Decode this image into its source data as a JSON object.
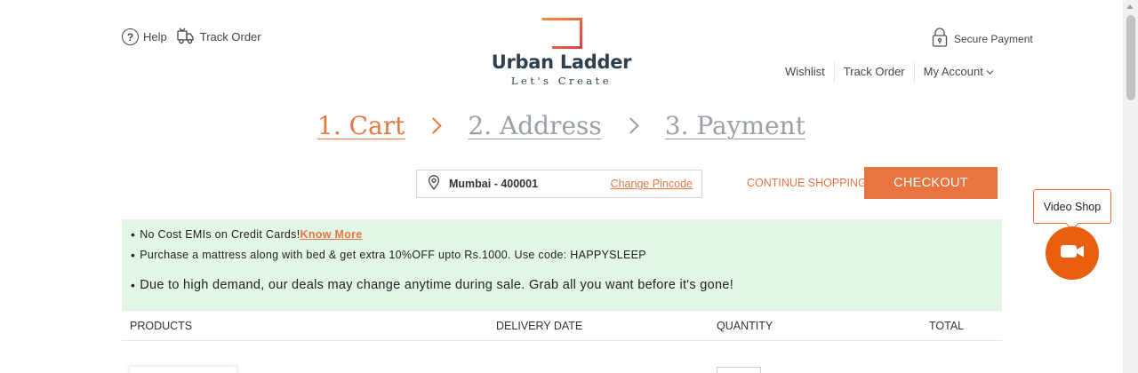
{
  "header": {
    "help_label": "Help",
    "track_order_label": "Track Order",
    "secure_payment_label": "Secure Payment"
  },
  "logo": {
    "name": "Urban Ladder",
    "tagline": "Let's Create"
  },
  "account_nav": {
    "wishlist": "Wishlist",
    "track_order": "Track Order",
    "my_account": "My Account"
  },
  "steps": [
    {
      "label": "1. Cart",
      "active": true
    },
    {
      "label": "2. Address",
      "active": false
    },
    {
      "label": "3. Payment",
      "active": false
    }
  ],
  "pincode": {
    "location": "Mumbai - 400001",
    "change_label": "Change Pincode"
  },
  "actions": {
    "continue_label": "CONTINUE SHOPPING",
    "checkout_label": "CHECKOUT"
  },
  "video_shop": {
    "label": "Video Shop"
  },
  "offers": {
    "line1_text": "No Cost EMIs on Credit Cards!",
    "line1_link": "Know More",
    "line2_text": "Purchase a mattress along with bed & get extra 10%OFF upto Rs.1000. Use code: HAPPYSLEEP",
    "line3_text": "Due to high demand, our deals may change anytime during sale. Grab all you want before it's gone!"
  },
  "table": {
    "headers": {
      "products": "PRODUCTS",
      "delivery_date": "DELIVERY DATE",
      "quantity": "QUANTITY",
      "total": "TOTAL"
    }
  },
  "colors": {
    "accent": "#e8743f",
    "offer_bg": "#e1f6e5",
    "video_btn": "#e8600f",
    "step_inactive": "#9aa0a6",
    "logo_text": "#2e4050"
  },
  "icons": {
    "help": "help-circle-icon",
    "track": "delivery-truck-icon",
    "secure": "padlock-icon",
    "location": "map-pin-icon",
    "chevron": "chevron-down-icon",
    "video": "video-camera-icon"
  }
}
